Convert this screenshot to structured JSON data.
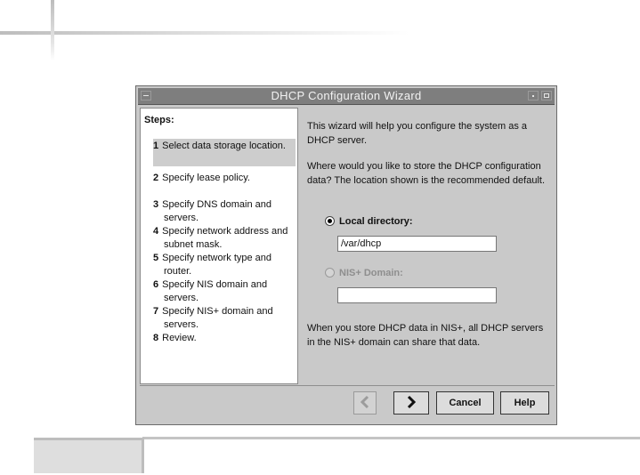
{
  "window": {
    "title": "DHCP Configuration Wizard"
  },
  "steps": {
    "title": "Steps:",
    "items": [
      {
        "num": "1",
        "line1": "Select data storage location.",
        "line2": ""
      },
      {
        "num": "2",
        "line1": "Specify lease policy.",
        "line2": ""
      },
      {
        "num": "3",
        "line1": "Specify DNS domain and",
        "line2": "servers."
      },
      {
        "num": "4",
        "line1": "Specify network address and",
        "line2": "subnet mask."
      },
      {
        "num": "5",
        "line1": "Specify network type and",
        "line2": "router."
      },
      {
        "num": "6",
        "line1": "Specify NIS domain and",
        "line2": "servers."
      },
      {
        "num": "7",
        "line1": "Specify NIS+ domain and",
        "line2": "servers."
      },
      {
        "num": "8",
        "line1": "Review.",
        "line2": ""
      }
    ],
    "active_step": 1
  },
  "content": {
    "intro": "This wizard will help you configure the system as a DHCP server.",
    "question": "Where would you like to store the DHCP configuration data?  The location shown is the recommended default.",
    "local_option": {
      "label": "Local directory:",
      "selected": true,
      "value": "/var/dhcp"
    },
    "nis_option": {
      "label": "NIS+ Domain:",
      "selected": false,
      "enabled": false,
      "value": ""
    },
    "note": "When you store DHCP data in NIS+, all DHCP servers in the NIS+ domain can share that data."
  },
  "buttons": {
    "back_icon": "chevron-left-icon",
    "next_icon": "chevron-right-icon",
    "cancel": "Cancel",
    "help": "Help"
  }
}
